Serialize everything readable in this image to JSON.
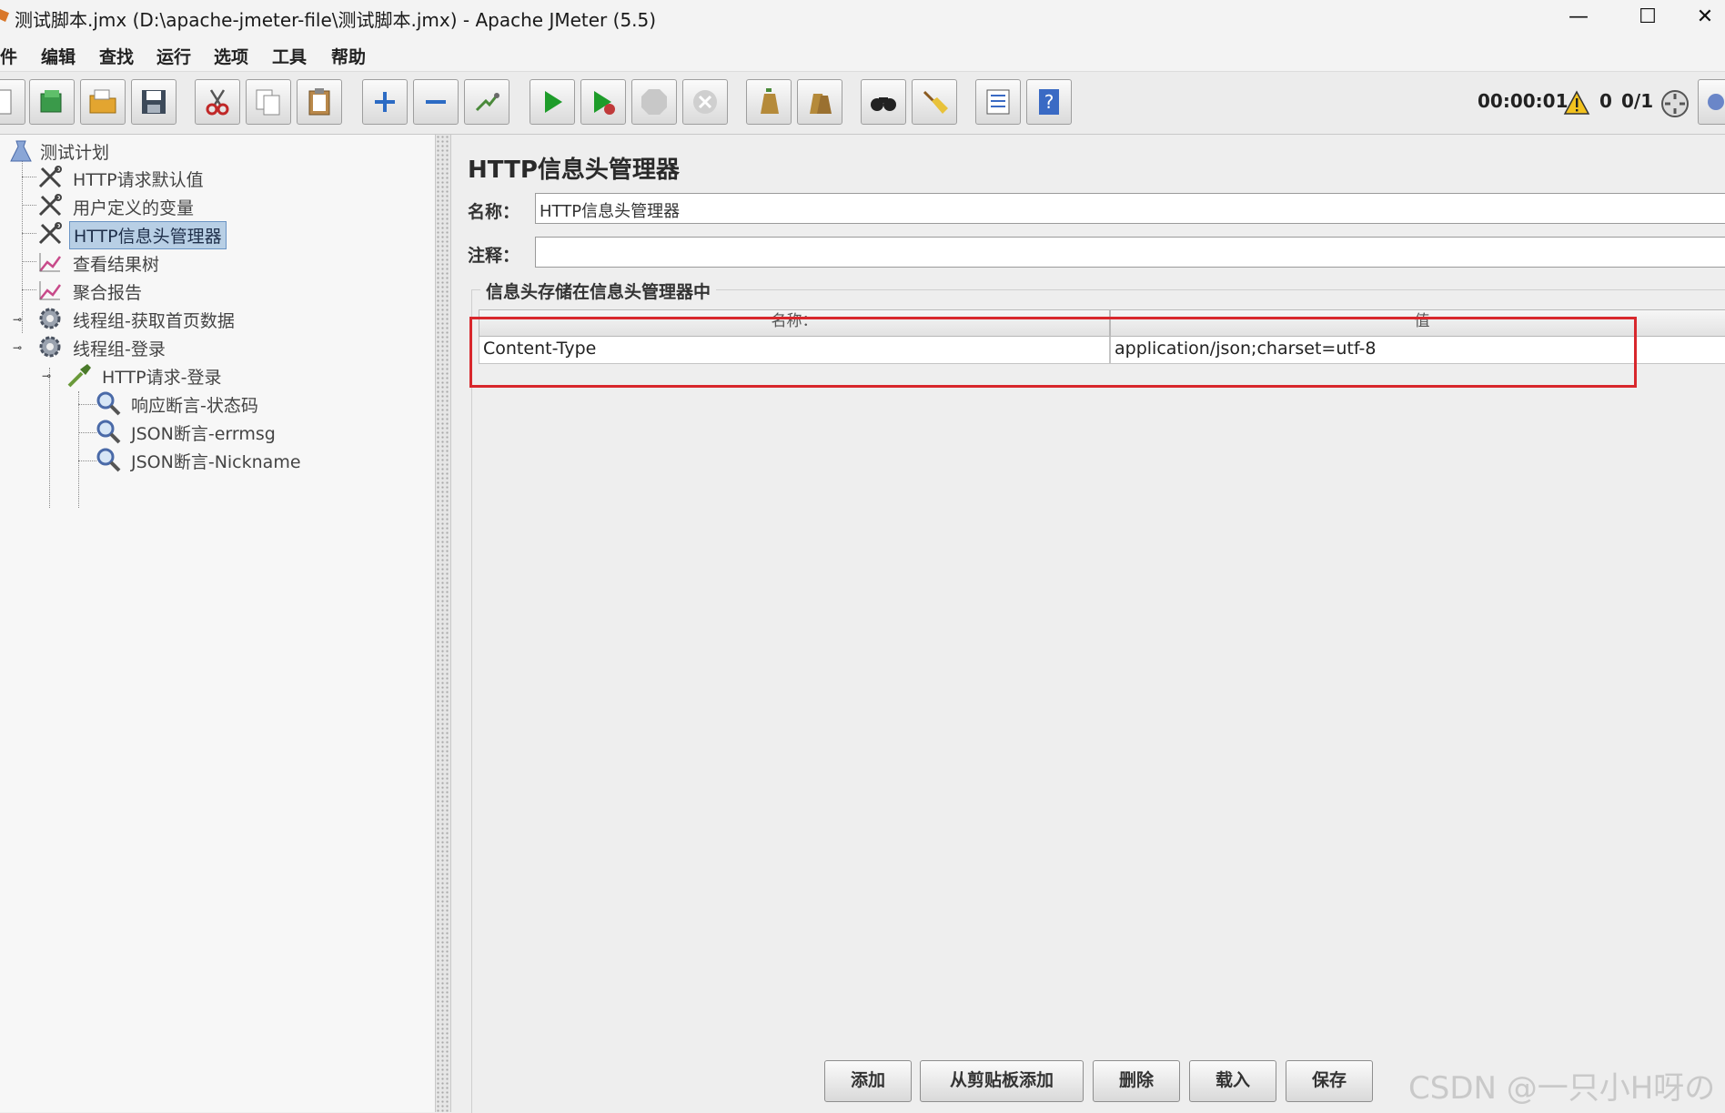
{
  "window": {
    "title": "测试脚本.jmx (D:\\apache-jmeter-file\\测试脚本.jmx) - Apache JMeter (5.5)",
    "minimize_glyph": "—",
    "maximize_glyph": "☐",
    "close_glyph": "✕"
  },
  "menu": {
    "items": [
      "件",
      "编辑",
      "查找",
      "运行",
      "选项",
      "工具",
      "帮助"
    ]
  },
  "toolbar": {
    "icons": [
      "new-icon",
      "templates-icon",
      "open-icon",
      "save-icon",
      "cut-icon",
      "copy-icon",
      "paste-icon",
      "expand-icon",
      "collapse-icon",
      "toggle-icon",
      "start-icon",
      "start-no-pause-icon",
      "stop-icon",
      "shutdown-icon",
      "clear-icon",
      "clear-all-icon",
      "search-icon",
      "reset-search-icon",
      "function-helper-icon",
      "help-icon"
    ],
    "timer": "00:00:01",
    "warning_count": "0",
    "threads": "0/1"
  },
  "tree": {
    "nodes": [
      {
        "label": "测试计划",
        "icon": "test-plan-icon"
      },
      {
        "label": "HTTP请求默认值",
        "icon": "config-tool-icon"
      },
      {
        "label": "用户定义的变量",
        "icon": "config-tool-icon"
      },
      {
        "label": "HTTP信息头管理器",
        "icon": "config-tool-icon",
        "selected": true
      },
      {
        "label": "查看结果树",
        "icon": "listener-chart-icon"
      },
      {
        "label": "聚合报告",
        "icon": "listener-chart-icon"
      },
      {
        "label": "线程组-获取首页数据",
        "icon": "thread-group-gear-icon",
        "expanded": false
      },
      {
        "label": "线程组-登录",
        "icon": "thread-group-gear-icon",
        "expanded": true
      },
      {
        "label": "HTTP请求-登录",
        "icon": "sampler-pipette-icon",
        "expanded": true
      },
      {
        "label": "响应断言-状态码",
        "icon": "assertion-magnifier-icon"
      },
      {
        "label": "JSON断言-errmsg",
        "icon": "assertion-magnifier-icon"
      },
      {
        "label": "JSON断言-Nickname",
        "icon": "assertion-magnifier-icon"
      }
    ]
  },
  "panel": {
    "title": "HTTP信息头管理器",
    "name_label": "名称：",
    "name_value": "HTTP信息头管理器",
    "comment_label": "注释：",
    "comment_value": "",
    "group_title": "信息头存储在信息头管理器中",
    "table": {
      "columns": [
        "名称：",
        "值"
      ],
      "rows": [
        {
          "name": "Content-Type",
          "value": "application/json;charset=utf-8"
        }
      ]
    },
    "buttons": {
      "add": "添加",
      "add_from_clipboard": "从剪贴板添加",
      "delete": "删除",
      "load": "载入",
      "save": "保存"
    }
  },
  "watermark": "CSDN @一只小H呀の",
  "colors": {
    "highlight_border": "#d8272c",
    "selection_bg": "#b8cfe5",
    "start_green": "#1e9c2a"
  }
}
